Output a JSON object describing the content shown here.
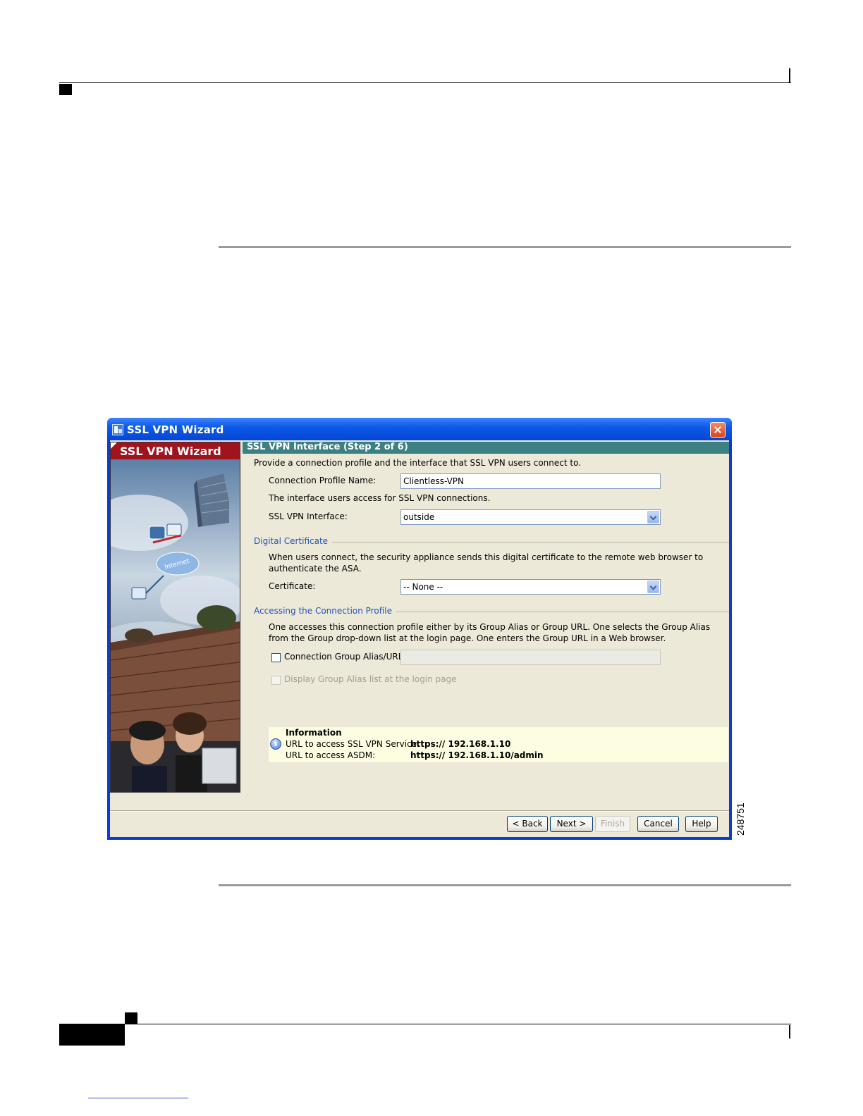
{
  "figure_id": "248751",
  "dialog": {
    "window_title": "SSL VPN Wizard",
    "side_panel_title": "SSL VPN Wizard",
    "step_title": "SSL VPN Interface  (Step 2 of 6)",
    "intro": "Provide a connection profile and the interface that SSL VPN users connect to.",
    "connection_profile_label": "Connection Profile Name:",
    "connection_profile_value": "Clientless-VPN",
    "interface_help": "The interface users access for SSL VPN connections.",
    "interface_label": "SSL VPN Interface:",
    "interface_value": "outside",
    "digital_certificate": {
      "title": "Digital Certificate",
      "description": "When users connect, the security appliance sends this digital certificate to the remote web browser to authenticate the ASA.",
      "certificate_label": "Certificate:",
      "certificate_value": "-- None --"
    },
    "accessing_profile": {
      "title": "Accessing the Connection Profile",
      "description": "One accesses this connection profile either by its Group Alias or Group URL. One selects the Group Alias from the Group drop-down list at the login page. One enters the Group URL in a Web browser.",
      "group_alias_checkbox_label": "Connection Group Alias/URL",
      "group_alias_checked": false,
      "group_alias_value": "",
      "display_alias_checkbox_label": "Display Group Alias list at the login page",
      "display_alias_checked": false
    },
    "information": {
      "title": "Information",
      "ssl_vpn_label": "URL to access SSL VPN Service:",
      "ssl_vpn_url": "https:// 192.168.1.10",
      "asdm_label": "URL to access ASDM:",
      "asdm_url": "https:// 192.168.1.10/admin"
    },
    "buttons": {
      "back": "< Back",
      "next": "Next >",
      "finish": "Finish",
      "cancel": "Cancel",
      "help": "Help"
    }
  },
  "colors": {
    "title_bar": "#0a3bd4",
    "side_banner": "#a0141e",
    "step_header": "#3b8082",
    "group_title": "#2254b8",
    "info_background": "#fdfde1"
  },
  "icons": [
    "app-icon",
    "close-icon",
    "info-icon",
    "chevron-down-icon"
  ]
}
